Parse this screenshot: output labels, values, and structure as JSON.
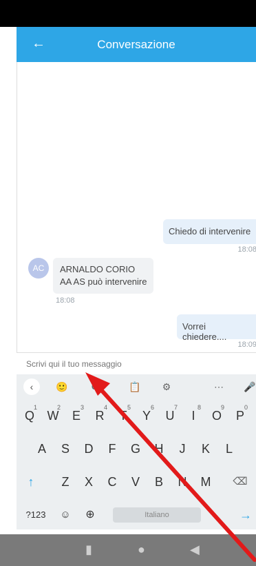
{
  "header": {
    "title": "Conversazione",
    "back_icon": "←"
  },
  "messages": [
    {
      "side": "out",
      "text": "Chiedo di intervenire",
      "time": "18:08"
    },
    {
      "side": "in",
      "avatar": "AC",
      "name": "ARNALDO CORIO",
      "text": "AA AS può intervenire",
      "time": "18:08"
    },
    {
      "side": "out",
      "text": "Vorrei chiedere....",
      "time": "18:09"
    }
  ],
  "composer": {
    "placeholder": "Scrivi qui il tuo messaggio"
  },
  "keyboard": {
    "toolbar": [
      "‹",
      "🙂",
      "GIF",
      "📋",
      "⚙",
      "⋯",
      "🎤"
    ],
    "row1": [
      {
        "k": "Q",
        "n": "1"
      },
      {
        "k": "W",
        "n": "2"
      },
      {
        "k": "E",
        "n": "3"
      },
      {
        "k": "R",
        "n": "4"
      },
      {
        "k": "T",
        "n": "5"
      },
      {
        "k": "Y",
        "n": "6"
      },
      {
        "k": "U",
        "n": "7"
      },
      {
        "k": "I",
        "n": "8"
      },
      {
        "k": "O",
        "n": "9"
      },
      {
        "k": "P",
        "n": "0"
      }
    ],
    "row2": [
      "A",
      "S",
      "D",
      "F",
      "G",
      "H",
      "J",
      "K",
      "L"
    ],
    "row3": [
      "↑",
      "Z",
      "X",
      "C",
      "V",
      "B",
      "N",
      "M",
      "⌫"
    ],
    "row4": {
      "sym": "?123",
      "emoji": "☺",
      "globe": "⊕",
      "space": "Italiano",
      "dot": ".",
      "enter": "→"
    },
    "accent_color": "#2ea6e6"
  },
  "nav": {
    "recent": "▮",
    "home": "●",
    "back": "◀"
  }
}
